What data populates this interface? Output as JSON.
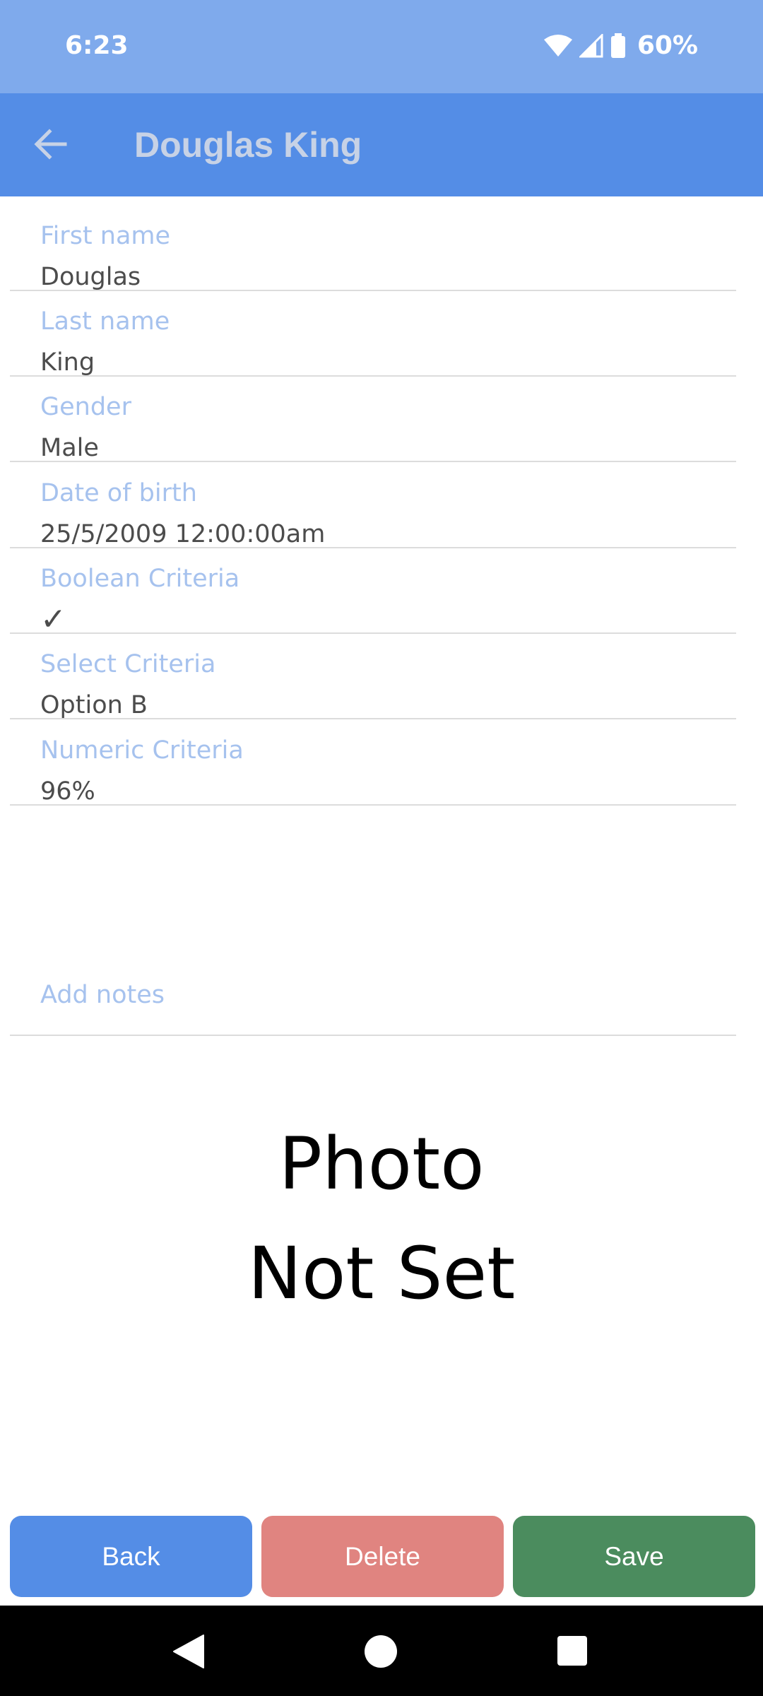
{
  "status_bar": {
    "time": "6:23",
    "battery": "60%",
    "icons": [
      "wifi-icon",
      "signal-icon",
      "battery-icon"
    ]
  },
  "app_bar": {
    "title": "Douglas King",
    "back_icon": "arrow-left-icon"
  },
  "fields": [
    {
      "label": "First name",
      "value": "Douglas"
    },
    {
      "label": "Last name",
      "value": "King"
    },
    {
      "label": "Gender",
      "value": "Male"
    },
    {
      "label": "Date of birth",
      "value": "25/5/2009 12:00:00am"
    },
    {
      "label": "Boolean Criteria",
      "value": "✓"
    },
    {
      "label": "Select Criteria",
      "value": "Option B"
    },
    {
      "label": "Numeric Criteria",
      "value": "96%"
    }
  ],
  "notes": {
    "placeholder": "Add notes"
  },
  "photo": {
    "line1": "Photo",
    "line2": "Not Set"
  },
  "buttons": {
    "back": "Back",
    "delete": "Delete",
    "save": "Save"
  },
  "colors": {
    "status_bar": "#7faaec",
    "app_bar": "#548de6",
    "label": "#a6c2ee",
    "back_button": "#548de6",
    "delete_button": "#e08480",
    "save_button": "#4b8c5e"
  }
}
